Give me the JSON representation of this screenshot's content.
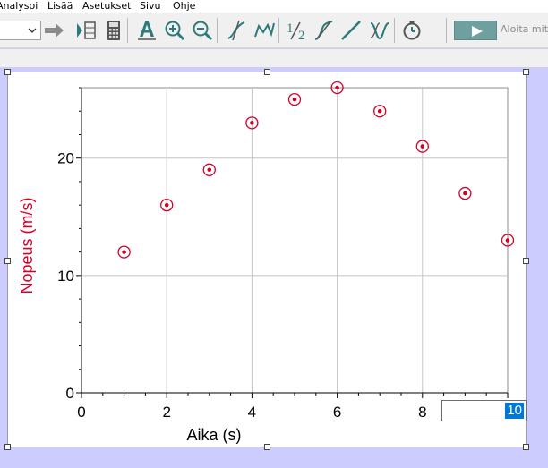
{
  "menu": {
    "items": [
      "Analysoi",
      "Lisää",
      "Asetukset",
      "Sivu",
      "Ohje"
    ]
  },
  "toolbar": {
    "tools": [
      {
        "name": "forward-arrow-icon",
        "sep_before": false
      },
      {
        "name": "data-browser-icon",
        "sep_before": false
      },
      {
        "name": "calculator-icon",
        "sep_before": false
      },
      {
        "name": "autoscale-icon",
        "sep_before": true
      },
      {
        "name": "zoom-in-icon",
        "sep_before": false
      },
      {
        "name": "zoom-out-icon",
        "sep_before": false
      },
      {
        "name": "examine-icon",
        "sep_before": true
      },
      {
        "name": "interpolate-icon",
        "sep_before": false
      },
      {
        "name": "integral-icon",
        "sep_before": true
      },
      {
        "name": "tangent-icon",
        "sep_before": false
      },
      {
        "name": "linear-fit-icon",
        "sep_before": false
      },
      {
        "name": "curve-fit-icon",
        "sep_before": false
      },
      {
        "name": "stopwatch-icon",
        "sep_before": true
      }
    ],
    "collect_label": "Aloita mittaus"
  },
  "graph": {
    "axis_input_value": "10",
    "point_color": "#d4002a"
  },
  "chart_data": {
    "type": "scatter",
    "xlabel": "Aika (s)",
    "ylabel": "Nopeus (m/s)",
    "xlim": [
      0,
      10
    ],
    "ylim": [
      0,
      26
    ],
    "x_ticks": [
      0,
      2,
      4,
      6,
      8,
      10
    ],
    "y_ticks": [
      0,
      10,
      20
    ],
    "grid": true,
    "series": [
      {
        "x": [
          1,
          2,
          3,
          4,
          5,
          6,
          7,
          8,
          9,
          10
        ],
        "y": [
          12,
          16,
          19,
          23,
          25,
          26,
          24,
          21,
          17,
          13
        ]
      }
    ]
  }
}
